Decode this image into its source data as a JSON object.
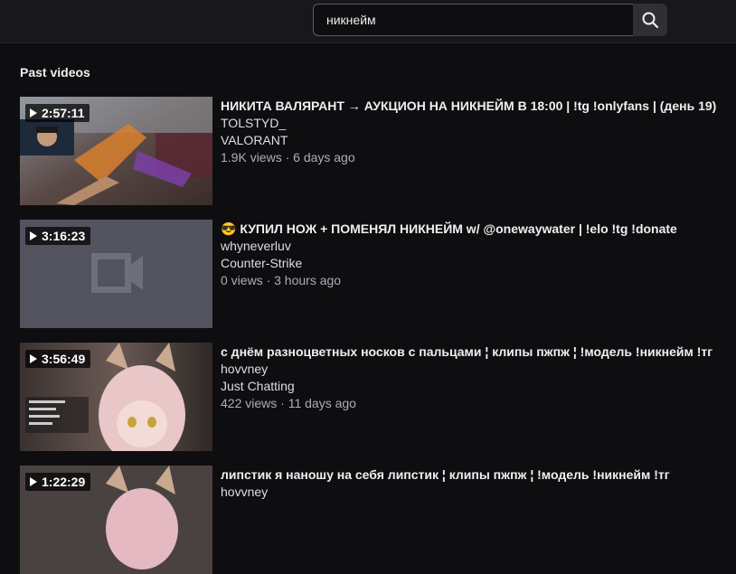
{
  "search": {
    "value": "никнейм"
  },
  "section_title": "Past videos",
  "videos": [
    {
      "duration": "2:57:11",
      "title": "НИКИТА ВАЛЯРАНТ → АУКЦИОН НА НИКНЕЙМ В 18:00 | !tg !onlyfans | (день 19)",
      "channel": "TOLSTYD_",
      "game": "VALORANT",
      "stats": "1.9K views · 6 days ago"
    },
    {
      "duration": "3:16:23",
      "title": "😎 КУПИЛ НОЖ + ПОМЕНЯЛ НИКНЕЙМ w/ @onewaywater | !elo !tg !donate",
      "channel": "whyneverluv",
      "game": "Counter-Strike",
      "stats": "0 views · 3 hours ago"
    },
    {
      "duration": "3:56:49",
      "title": "с днём разноцветных носков с пальцами ¦ клипы пжпж ¦ !модель !никнейм !тг",
      "channel": "hovvney",
      "game": "Just Chatting",
      "stats": "422 views · 11 days ago"
    },
    {
      "duration": "1:22:29",
      "title": "липстик я наношу на себя липстик ¦ клипы пжпж ¦ !модель !никнейм !тг",
      "channel": "hovvney",
      "game": "",
      "stats": ""
    }
  ]
}
